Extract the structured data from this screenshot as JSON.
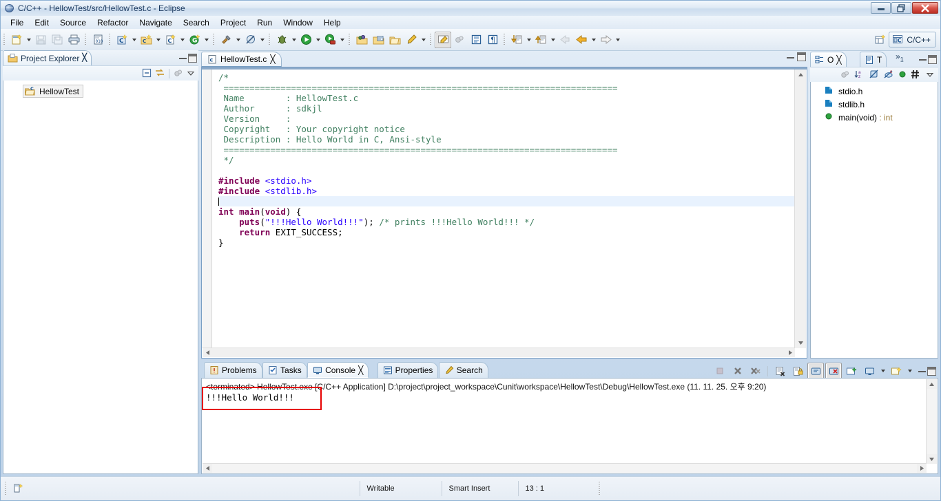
{
  "window": {
    "title": "C/C++ - HellowTest/src/HellowTest.c - Eclipse",
    "app_icon": "eclipse-globe-icon",
    "buttons": {
      "minimize": "Minimize",
      "restore": "Restore",
      "close": "Close"
    }
  },
  "menubar": {
    "items": [
      "File",
      "Edit",
      "Source",
      "Refactor",
      "Navigate",
      "Search",
      "Project",
      "Run",
      "Window",
      "Help"
    ]
  },
  "toolbar": {
    "groups": [
      {
        "name": "file-group",
        "buttons": [
          {
            "icon": "new-wizard-icon",
            "label": "New",
            "dropdown": true
          },
          {
            "icon": "save-icon",
            "label": "Save",
            "dropdown": false
          },
          {
            "icon": "save-all-icon",
            "label": "Save All",
            "dropdown": false
          },
          {
            "icon": "print-icon",
            "label": "Print",
            "dropdown": false
          }
        ]
      },
      {
        "name": "binary-group",
        "buttons": [
          {
            "icon": "binary-file-icon",
            "label": "Toggle Binary",
            "dropdown": false
          }
        ]
      },
      {
        "name": "c-project-group",
        "buttons": [
          {
            "icon": "new-c-cpp-project-icon",
            "label": "New C/C++ Project",
            "dropdown": true
          },
          {
            "icon": "new-c-folder-icon",
            "label": "New Source Folder",
            "dropdown": true
          },
          {
            "icon": "new-c-file-icon",
            "label": "New Source File",
            "dropdown": true
          },
          {
            "icon": "new-class-icon",
            "label": "New Class",
            "dropdown": true
          }
        ]
      },
      {
        "name": "build-group",
        "buttons": [
          {
            "icon": "build-hammer-icon",
            "label": "Build",
            "dropdown": true
          },
          {
            "icon": "clean-icon",
            "label": "Clean",
            "dropdown": true
          }
        ]
      },
      {
        "name": "run-group",
        "buttons": [
          {
            "icon": "debug-bug-icon",
            "label": "Debug",
            "dropdown": true
          },
          {
            "icon": "run-play-icon",
            "label": "Run",
            "dropdown": true
          },
          {
            "icon": "external-tools-icon",
            "label": "External Tools",
            "dropdown": true
          }
        ]
      },
      {
        "name": "open-group",
        "buttons": [
          {
            "icon": "open-type-icon",
            "label": "Open Type",
            "dropdown": false
          },
          {
            "icon": "open-declaration-icon",
            "label": "Open Element",
            "dropdown": false
          },
          {
            "icon": "open-resource-icon",
            "label": "Open Resource",
            "dropdown": false
          },
          {
            "icon": "search-pen-icon",
            "label": "Search",
            "dropdown": true
          }
        ]
      },
      {
        "name": "marker-group",
        "buttons": [
          {
            "icon": "highlight-marker-icon",
            "label": "Toggle Mark Occurrences",
            "dropdown": false,
            "pressed": true
          },
          {
            "icon": "toggle-block-icon",
            "label": "Toggle Block Selection",
            "dropdown": false
          },
          {
            "icon": "show-whitespace-icon",
            "label": "Show Whitespace",
            "dropdown": false
          },
          {
            "icon": "pilcrow-icon",
            "label": "Show Print Margin",
            "dropdown": false
          }
        ]
      },
      {
        "name": "nav-group",
        "buttons": [
          {
            "icon": "next-annotation-icon",
            "label": "Next Annotation",
            "dropdown": true
          },
          {
            "icon": "previous-annotation-icon",
            "label": "Previous Annotation",
            "dropdown": true
          },
          {
            "icon": "last-edit-location-icon",
            "label": "Last Edit Location",
            "dropdown": false
          },
          {
            "icon": "back-arrow-icon",
            "label": "Back",
            "dropdown": true
          },
          {
            "icon": "forward-arrow-icon",
            "label": "Forward",
            "dropdown": true
          }
        ]
      }
    ],
    "perspective": {
      "open_perspective_icon": "open-perspective-icon",
      "active_icon": "c-cpp-perspective-icon",
      "active_label": "C/C++"
    }
  },
  "project_explorer": {
    "tab_label": "Project Explorer",
    "tab_icon": "project-explorer-icon",
    "close_glyph": "╳",
    "toolbar_icons": [
      "collapse-all-icon",
      "link-with-editor-icon",
      "view-menu-icon",
      "view-dropdown-icon"
    ],
    "tree": [
      {
        "label": "HellowTest",
        "icon": "c-project-folder-icon",
        "selected": true
      }
    ]
  },
  "editor": {
    "tab_label": "HellowTest.c",
    "tab_icon": "c-file-icon",
    "close_glyph": "╳",
    "status_min": "Minimize",
    "status_max": "Maximize",
    "code_lines": [
      {
        "segments": [
          {
            "t": "/*",
            "c": "cmt"
          }
        ]
      },
      {
        "segments": [
          {
            "t": " ============================================================================",
            "c": "cmt"
          }
        ]
      },
      {
        "segments": [
          {
            "t": " Name        : HellowTest.c",
            "c": "cmt"
          }
        ]
      },
      {
        "segments": [
          {
            "t": " Author      : sdkjl",
            "c": "cmt"
          }
        ]
      },
      {
        "segments": [
          {
            "t": " Version     :",
            "c": "cmt"
          }
        ]
      },
      {
        "segments": [
          {
            "t": " Copyright   : Your copyright notice",
            "c": "cmt"
          }
        ]
      },
      {
        "segments": [
          {
            "t": " Description : Hello World in C, Ansi-style",
            "c": "cmt"
          }
        ]
      },
      {
        "segments": [
          {
            "t": " ============================================================================",
            "c": "cmt"
          }
        ]
      },
      {
        "segments": [
          {
            "t": " */",
            "c": "cmt"
          }
        ]
      },
      {
        "segments": [
          {
            "t": "",
            "c": ""
          }
        ]
      },
      {
        "segments": [
          {
            "t": "#include ",
            "c": "pp"
          },
          {
            "t": "<stdio.h>",
            "c": "inc"
          }
        ]
      },
      {
        "segments": [
          {
            "t": "#include ",
            "c": "pp"
          },
          {
            "t": "<stdlib.h>",
            "c": "inc"
          }
        ]
      },
      {
        "segments": [
          {
            "t": "",
            "c": "caret"
          }
        ]
      },
      {
        "segments": [
          {
            "t": "int ",
            "c": "kw"
          },
          {
            "t": "main",
            "c": "kw"
          },
          {
            "t": "(",
            "c": ""
          },
          {
            "t": "void",
            "c": "kw"
          },
          {
            "t": ") {",
            "c": ""
          }
        ]
      },
      {
        "segments": [
          {
            "t": "    ",
            "c": ""
          },
          {
            "t": "puts",
            "c": "kw"
          },
          {
            "t": "(",
            "c": ""
          },
          {
            "t": "\"!!!Hello World!!!\"",
            "c": "str"
          },
          {
            "t": "); ",
            "c": ""
          },
          {
            "t": "/* prints !!!Hello World!!! */",
            "c": "cmt"
          }
        ]
      },
      {
        "segments": [
          {
            "t": "    ",
            "c": ""
          },
          {
            "t": "return",
            "c": "kw"
          },
          {
            "t": " EXIT_SUCCESS;",
            "c": ""
          }
        ]
      },
      {
        "segments": [
          {
            "t": "}",
            "c": ""
          }
        ]
      }
    ]
  },
  "outline": {
    "tabs": [
      {
        "label": "O",
        "icon": "outline-icon",
        "active": true,
        "close_glyph": "╳"
      },
      {
        "label": "T",
        "icon": "task-list-icon",
        "active": false
      }
    ],
    "overflow_label": "»",
    "overflow_count": "1",
    "toolbar_icons": [
      "hide-fields-icon",
      "sort-az-icon",
      "hide-non-public-icon",
      "hide-static-icon",
      "hide-functions-icon",
      "hide-macros-icon",
      "view-menu-icon"
    ],
    "items": [
      {
        "label": "stdio.h",
        "icon": "include-icon",
        "type": ""
      },
      {
        "label": "stdlib.h",
        "icon": "include-icon",
        "type": ""
      },
      {
        "label": "main(void)",
        "icon": "function-icon",
        "type": " : int"
      }
    ]
  },
  "console": {
    "tabs": [
      {
        "label": "Problems",
        "icon": "problems-icon",
        "active": false
      },
      {
        "label": "Tasks",
        "icon": "tasks-icon",
        "active": false
      },
      {
        "label": "Console",
        "icon": "console-icon",
        "active": true,
        "close_glyph": "╳"
      },
      {
        "label": "Properties",
        "icon": "properties-icon",
        "active": false
      },
      {
        "label": "Search",
        "icon": "search-pen-icon",
        "active": false
      }
    ],
    "toolbar_icons": [
      "terminate-icon",
      "remove-launch-icon",
      "remove-all-terminated-icon",
      "clear-console-icon",
      "scroll-lock-icon",
      "pin-console-icon",
      "display-selected-console-icon",
      "open-console-icon",
      "new-console-view-icon",
      "minimize-icon",
      "maximize-icon"
    ],
    "header_terminated": "<terminated> HellowTest.exe",
    "header_rest": " [C/C++ Application] D:\\project\\project_workspace\\Cunit\\workspace\\HellowTest\\Debug\\HellowTest.exe (11. 11. 25. 오후 9:20)",
    "output": "!!!Hello World!!!",
    "highlight_color": "#e60000"
  },
  "statusbar": {
    "icon": "editor-status-icon",
    "cells": [
      "Writable",
      "Smart Insert",
      "13 : 1"
    ]
  }
}
